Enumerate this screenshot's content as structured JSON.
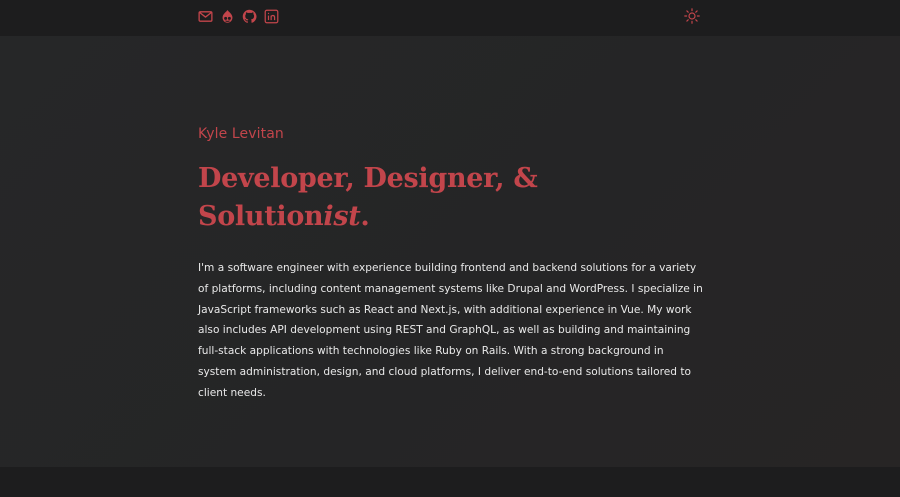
{
  "header": {
    "social_links": [
      {
        "icon": "mail-icon",
        "label": "Email"
      },
      {
        "icon": "drupal-icon",
        "label": "Drupal"
      },
      {
        "icon": "github-icon",
        "label": "GitHub"
      },
      {
        "icon": "linkedin-icon",
        "label": "LinkedIn"
      }
    ],
    "theme_toggle_icon": "sun-icon"
  },
  "hero": {
    "name": "Kyle Levitan",
    "headline_line1": "Developer, Designer, &",
    "headline_line2_regular": "Solution",
    "headline_line2_italic": "ist",
    "headline_line2_end": ".",
    "bio": "I'm a software engineer with experience building frontend and backend solutions for a variety of platforms, including content management systems like Drupal and WordPress. I specialize in JavaScript frameworks such as React and Next.js, with additional experience in Vue. My work also includes API development using REST and GraphQL, as well as building and maintaining full-stack applications with technologies like Ruby on Rails. With a strong background in system administration, design, and cloud platforms, I deliver end-to-end solutions tailored to client needs."
  },
  "colors": {
    "accent": "#c2454b",
    "background": "#252526",
    "header_background": "#1d1d1e",
    "text": "#e9e9e9"
  }
}
